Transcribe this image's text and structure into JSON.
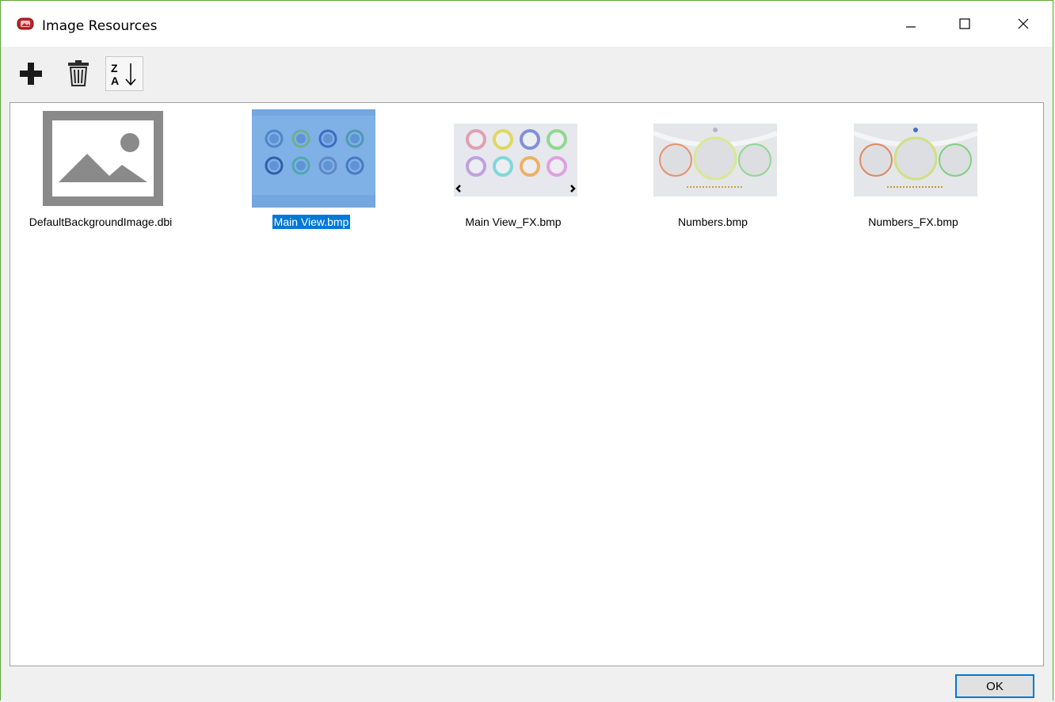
{
  "window": {
    "title": "Image Resources",
    "controls": {
      "minimize": "minimize-icon",
      "maximize": "maximize-icon",
      "close": "close-icon"
    }
  },
  "toolbar": {
    "add_icon": "plus-icon",
    "delete_icon": "trash-icon",
    "sort_icon": "sort-z-a-icon",
    "sort_top": "Z",
    "sort_bottom": "A"
  },
  "resources": [
    {
      "name": "DefaultBackgroundImage.dbi",
      "selected": false,
      "thumbnail": "image-placeholder-icon"
    },
    {
      "name": "Main View.bmp",
      "selected": true,
      "thumbnail": "main-view-thumbnail"
    },
    {
      "name": "Main View_FX.bmp",
      "selected": false,
      "thumbnail": "main-view-fx-thumbnail"
    },
    {
      "name": "Numbers.bmp",
      "selected": false,
      "thumbnail": "numbers-thumbnail"
    },
    {
      "name": "Numbers_FX.bmp",
      "selected": false,
      "thumbnail": "numbers-fx-thumbnail"
    }
  ],
  "footer": {
    "ok_label": "OK"
  },
  "colors": {
    "selection": "#0078d7",
    "window_border": "#5fa83a"
  }
}
